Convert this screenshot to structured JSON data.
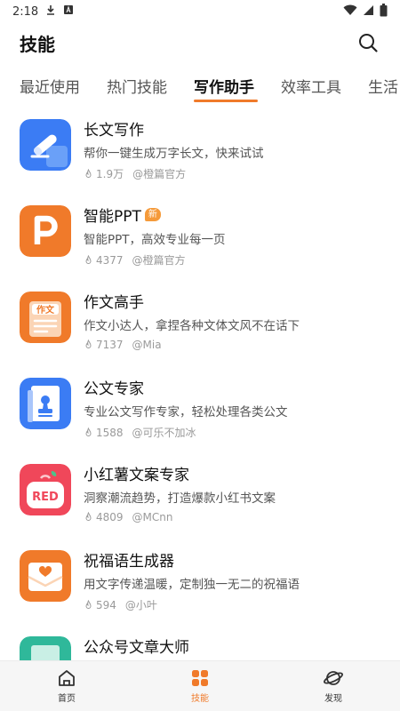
{
  "status_bar": {
    "time": "2:18"
  },
  "header": {
    "title": "技能"
  },
  "tabs": [
    {
      "label": "最近使用"
    },
    {
      "label": "热门技能"
    },
    {
      "label": "写作助手",
      "active": true
    },
    {
      "label": "效率工具"
    },
    {
      "label": "生活"
    }
  ],
  "items": [
    {
      "title": "长文写作",
      "desc": "帮你一键生成万字长文，快来试试",
      "count": "1.9万",
      "author": "@橙篇官方",
      "icon": "pen-icon",
      "color": "#3b7cf4"
    },
    {
      "title": "智能PPT",
      "badge": "新",
      "desc": "智能PPT，高效专业每一页",
      "count": "4377",
      "author": "@橙篇官方",
      "icon": "ppt-icon",
      "color": "#f07a2a"
    },
    {
      "title": "作文高手",
      "desc": "作文小达人，拿捏各种文体文风不在话下",
      "count": "7137",
      "author": "@Mia",
      "icon": "essay-icon",
      "color": "#f07a2a",
      "icon_text": "作文"
    },
    {
      "title": "公文专家",
      "desc": "专业公文写作专家，轻松处理各类公文",
      "count": "1588",
      "author": "@可乐不加冰",
      "icon": "official-doc-icon",
      "color": "#3b7cf4"
    },
    {
      "title": "小红薯文案专家",
      "desc": "洞察潮流趋势，打造爆款小红书文案",
      "count": "4809",
      "author": "@MCnn",
      "icon": "red-bag-icon",
      "color": "#f0475a",
      "icon_text": "RED"
    },
    {
      "title": "祝福语生成器",
      "desc": "用文字传递温暖，定制独一无二的祝福语",
      "count": "594",
      "author": "@小叶",
      "icon": "greeting-card-icon",
      "color": "#f07a2a"
    },
    {
      "title": "公众号文章大师",
      "icon": "article-icon",
      "color": "#2fb89a"
    }
  ],
  "bottom_nav": [
    {
      "label": "首页",
      "icon": "home-icon"
    },
    {
      "label": "技能",
      "icon": "skills-grid-icon",
      "active": true
    },
    {
      "label": "发现",
      "icon": "planet-icon"
    }
  ]
}
